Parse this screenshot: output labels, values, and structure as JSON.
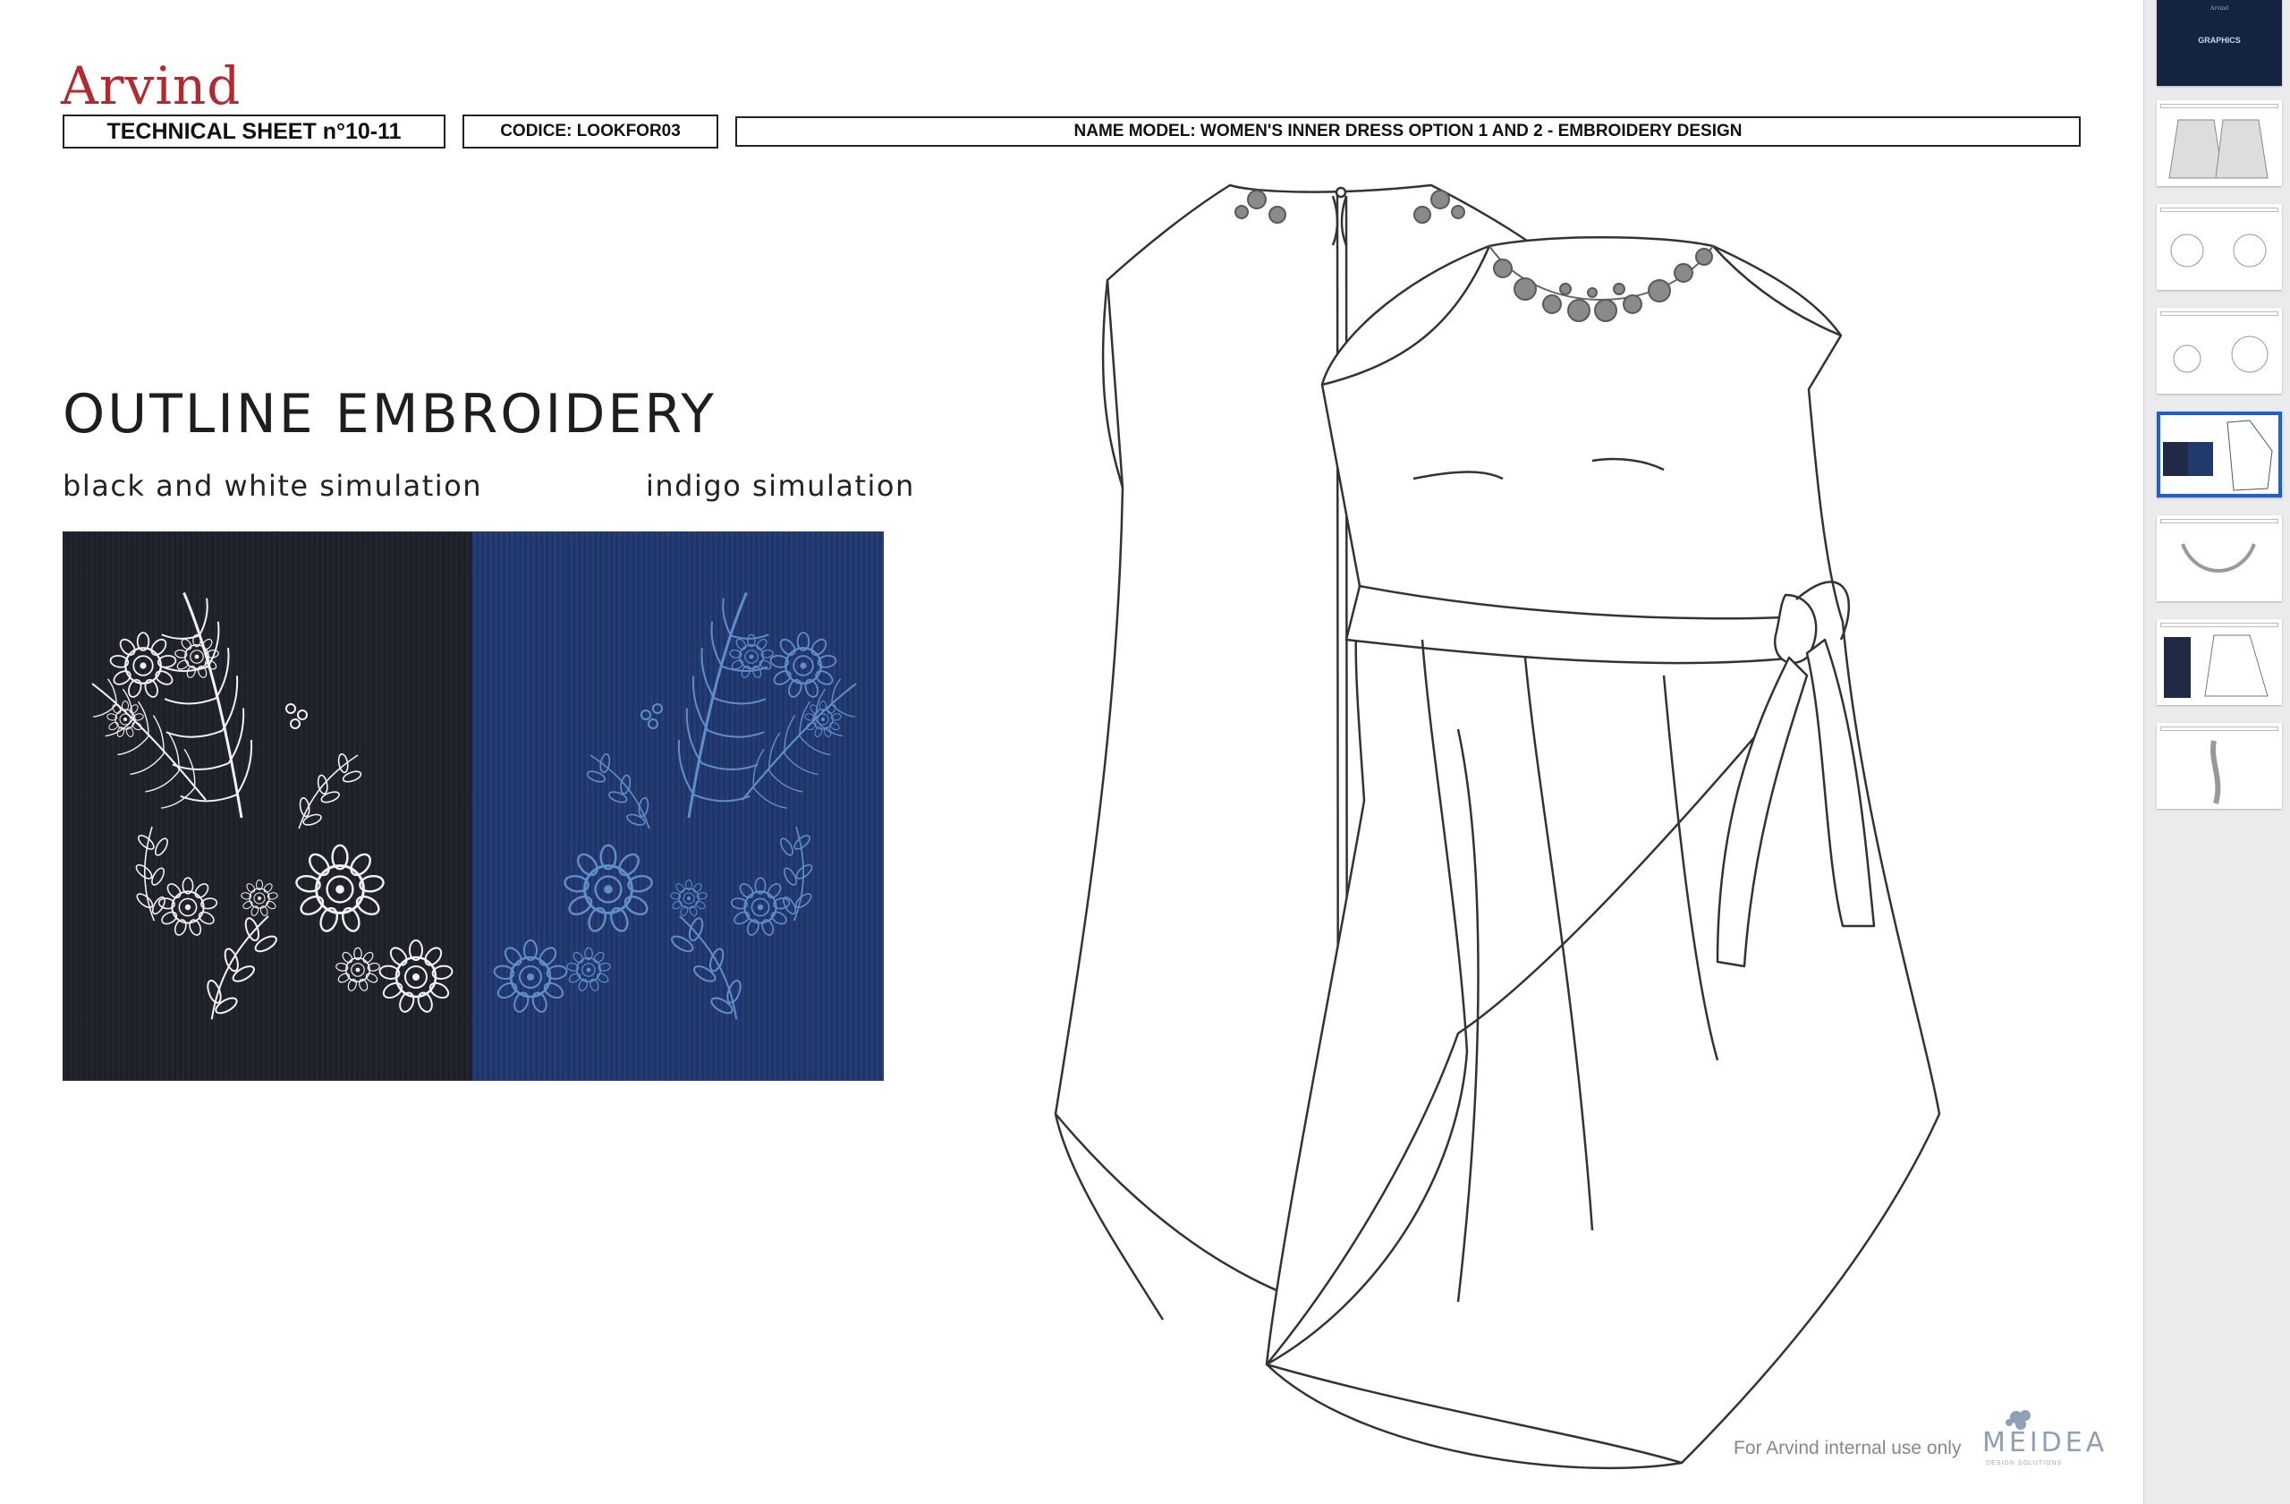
{
  "brand": {
    "logo_text": "Arvind",
    "accent_color": "#b5282e"
  },
  "header": {
    "sheet_label": "TECHNICAL SHEET n°10-11",
    "code_label": "CODICE: LOOKFOR03",
    "model_label": "NAME MODEL: WOMEN'S INNER DRESS OPTION 1 AND 2 - EMBROIDERY DESIGN"
  },
  "section": {
    "title": "OUTLINE EMBROIDERY",
    "left_caption": "black and white simulation",
    "right_caption": "indigo simulation"
  },
  "swatches": [
    {
      "name": "black and white simulation",
      "fabric_color": "#1f2229",
      "thread_color": "#f2f2f2"
    },
    {
      "name": "indigo simulation",
      "fabric_color": "#22396c",
      "thread_color": "#5f8fcb"
    }
  ],
  "footer": {
    "note": "For Arvind internal use only",
    "partner_logo": "MEIDEA",
    "partner_tagline": "DESIGN SOLUTIONS"
  },
  "sidebar": {
    "selected_index": 4,
    "thumbnails": [
      {
        "kind": "cover",
        "title": "GRAPHICS",
        "logo": "Arvind"
      },
      {
        "kind": "jacket-sketch"
      },
      {
        "kind": "embroidery-motifs"
      },
      {
        "kind": "embroidery-motifs-2"
      },
      {
        "kind": "outline-embroidery-dress"
      },
      {
        "kind": "necklace-embroidery"
      },
      {
        "kind": "coat-sketch"
      },
      {
        "kind": "vertical-motif"
      }
    ]
  }
}
